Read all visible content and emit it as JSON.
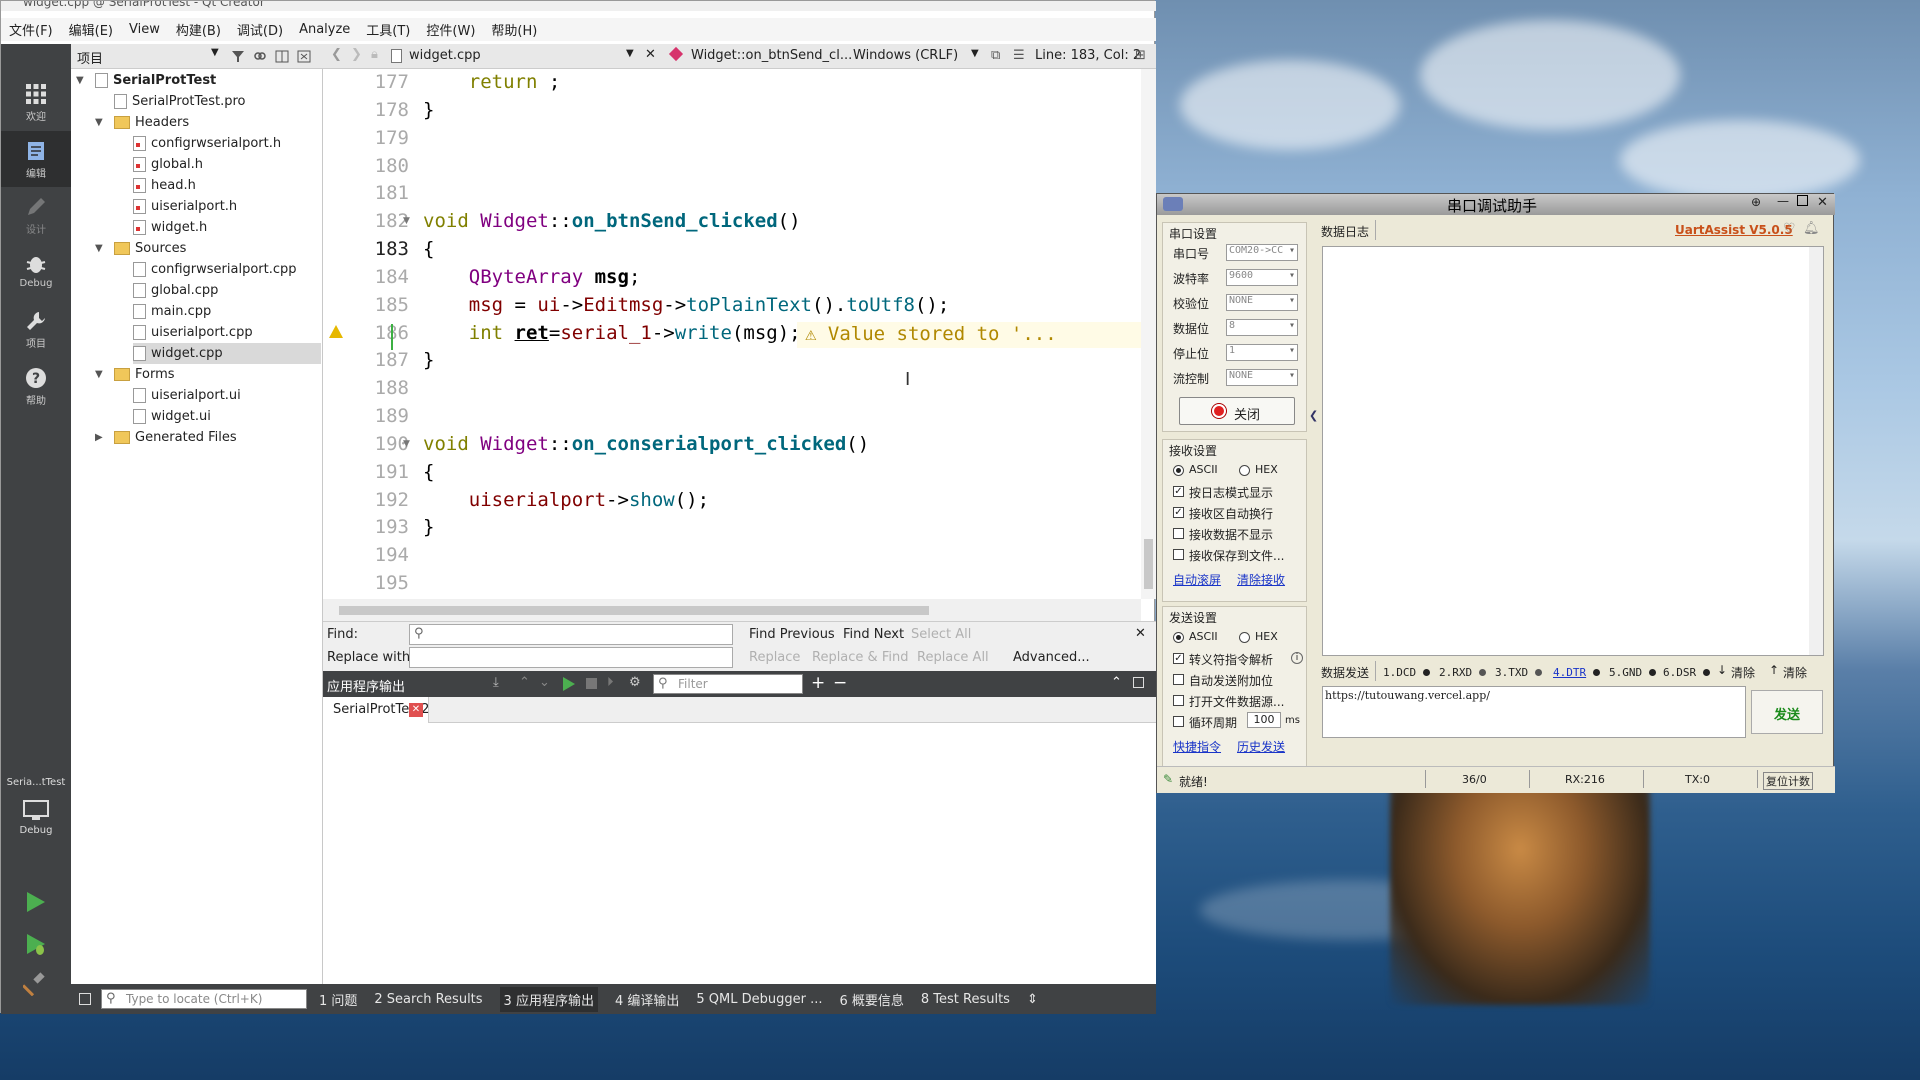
{
  "qt": {
    "title": "widget.cpp @ SerialProtTest - Qt Creator",
    "menus": [
      "文件(F)",
      "编辑(E)",
      "View",
      "构建(B)",
      "调试(D)",
      "Analyze",
      "工具(T)",
      "控件(W)",
      "帮助(H)"
    ],
    "modes": [
      "欢迎",
      "编辑",
      "设计",
      "Debug",
      "项目",
      "帮助"
    ],
    "kit": {
      "name": "Seria...tTest",
      "mode": "Debug"
    },
    "project_pane_title": "项目",
    "tree": {
      "project": "SerialProtTest",
      "pro_file": "SerialProtTest.pro",
      "headers_label": "Headers",
      "headers": [
        "configrwserialport.h",
        "global.h",
        "head.h",
        "uiserialport.h",
        "widget.h"
      ],
      "sources_label": "Sources",
      "sources": [
        "configrwserialport.cpp",
        "global.cpp",
        "main.cpp",
        "uiserialport.cpp",
        "widget.cpp"
      ],
      "forms_label": "Forms",
      "forms": [
        "uiserialport.ui",
        "widget.ui"
      ],
      "generated_label": "Generated Files"
    },
    "editor": {
      "file": "widget.cpp",
      "symbol": "Widget::on_btnSend_cl...",
      "encoding": "Windows (CRLF)",
      "position": "Line: 183, Col: 2",
      "line_numbers": [
        "177",
        "178",
        "179",
        "180",
        "181",
        "182",
        "183",
        "184",
        "185",
        "186",
        "187",
        "188",
        "189",
        "190",
        "191",
        "192",
        "193",
        "194",
        "195"
      ],
      "warning": "Value stored to '..."
    },
    "find": {
      "find_label": "Find:",
      "replace_label": "Replace with:",
      "find_previous": "Find Previous",
      "find_next": "Find Next",
      "select_all": "Select All",
      "replace": "Replace",
      "replace_find": "Replace & Find",
      "replace_all": "Replace All",
      "advanced": "Advanced..."
    },
    "output": {
      "title": "应用程序输出",
      "filter_placeholder": "Filter",
      "tab": "SerialProtTest2"
    },
    "statusbar": {
      "locate_placeholder": "Type to locate (Ctrl+K)",
      "items": [
        "1 问题",
        "2 Search Results",
        "3 应用程序输出",
        "4 编译输出",
        "5 QML Debugger ...",
        "6 概要信息",
        "8 Test Results"
      ]
    }
  },
  "ua": {
    "title": "串口调试助手",
    "version": "UartAssist V5.0.5",
    "log_tab": "数据日志",
    "port_group": "串口设置",
    "fields": [
      {
        "label": "串口号",
        "value": "COM20->CC"
      },
      {
        "label": "波特率",
        "value": "9600"
      },
      {
        "label": "校验位",
        "value": "NONE"
      },
      {
        "label": "数据位",
        "value": "8"
      },
      {
        "label": "停止位",
        "value": "1"
      },
      {
        "label": "流控制",
        "value": "NONE"
      }
    ],
    "close_button": "关闭",
    "recv_group": "接收设置",
    "ascii": "ASCII",
    "hex": "HEX",
    "recv_opts": [
      "按日志模式显示",
      "接收区自动换行",
      "接收数据不显示",
      "接收保存到文件..."
    ],
    "recv_checked": [
      true,
      true,
      false,
      false
    ],
    "recv_links": [
      "自动滚屏",
      "清除接收"
    ],
    "send_group": "发送设置",
    "send_opts": [
      "转义符指令解析",
      "自动发送附加位",
      "打开文件数据源...",
      "循环周期"
    ],
    "send_checked": [
      true,
      false,
      false,
      false
    ],
    "period_value": "100",
    "period_unit": "ms",
    "send_links": [
      "快捷指令",
      "历史发送"
    ],
    "send_tab": "数据发送",
    "signals": [
      "1.DCD",
      "2.RXD",
      "3.TXD",
      "4.DTR",
      "5.GND",
      "6.DSR"
    ],
    "clear1": "清除",
    "clear2": "清除",
    "send_text": "https://tutouwang.vercel.app/",
    "send_button": "发送",
    "status": "就绪!",
    "count": "36/0",
    "rx": "RX:216",
    "tx": "TX:0",
    "reset": "复位计数",
    "colors": {
      "version": "#c8501a",
      "link": "#1a35c8",
      "send_button": "#1a8a1a"
    }
  }
}
